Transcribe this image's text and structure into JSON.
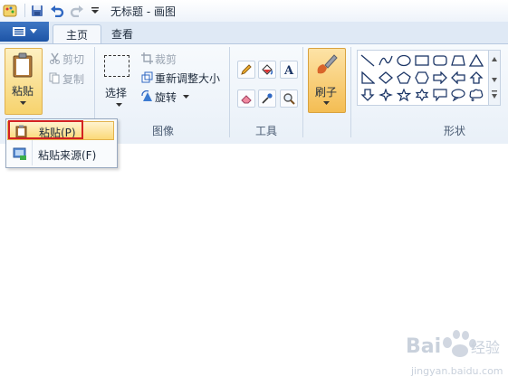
{
  "window": {
    "title": "无标题 - 画图"
  },
  "tabs": [
    {
      "label": "主页",
      "active": true
    },
    {
      "label": "查看",
      "active": false
    }
  ],
  "clipboard": {
    "paste_label": "粘贴",
    "cut_label": "剪切",
    "copy_label": "复制"
  },
  "image": {
    "select_label": "选择",
    "crop_label": "裁剪",
    "resize_label": "重新调整大小",
    "rotate_label": "旋转",
    "group_label": "图像"
  },
  "tools": {
    "group_label": "工具"
  },
  "brushes": {
    "label": "刷子"
  },
  "shapes": {
    "group_label": "形状"
  },
  "paste_menu": {
    "items": [
      {
        "label": "粘贴(P)",
        "highlighted": true
      },
      {
        "label": "粘贴来源(F)",
        "highlighted": false
      }
    ]
  },
  "watermark": {
    "brand": "Bai",
    "brand_suffix": "经验",
    "url": "jingyan.baidu.com"
  },
  "colors": {
    "ribbon_bg": "#e9f0f8",
    "accent_orange": "#f4bd53",
    "highlight_red": "#d32222",
    "file_button": "#1d54a6"
  }
}
